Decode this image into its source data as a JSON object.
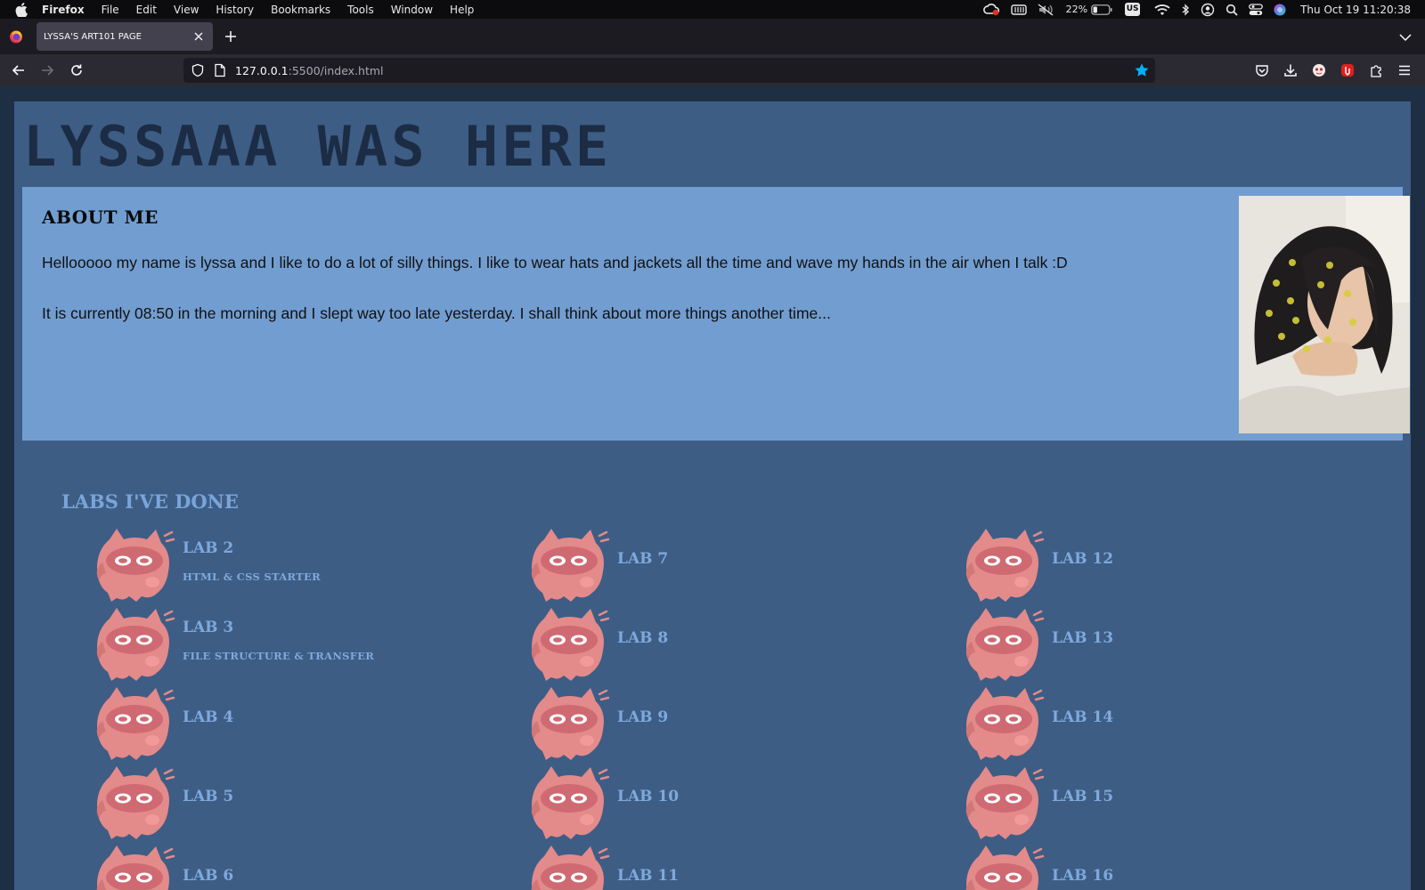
{
  "menubar": {
    "app": "Firefox",
    "items": [
      "File",
      "Edit",
      "View",
      "History",
      "Bookmarks",
      "Tools",
      "Window",
      "Help"
    ],
    "battery": "22%",
    "input_source": "US",
    "clock": "Thu Oct 19  11:20:38"
  },
  "browser": {
    "tab_title": "LYSSA'S ART101 PAGE",
    "url_host": "127.0.0.1",
    "url_rest": ":5500/index.html",
    "accent": "#00b3f4"
  },
  "page": {
    "headline": "LYSSAAA WAS HERE",
    "about": {
      "heading": "ABOUT ME",
      "p1": "Hellooooo my name is lyssa and I like to do a lot of silly things. I like to wear hats and jackets all the time and wave my hands in the air when I talk :D",
      "p2": "It is currently 08:50 in the morning and I slept way too late yesterday. I shall think about more things another time..."
    },
    "labs_heading": "LABS I'VE DONE",
    "labs": [
      {
        "name": "LAB 2",
        "sub": "HTML & CSS STARTER"
      },
      {
        "name": "LAB 3",
        "sub": "FILE STRUCTURE & TRANSFER"
      },
      {
        "name": "LAB 4",
        "sub": ""
      },
      {
        "name": "LAB 5",
        "sub": ""
      },
      {
        "name": "LAB 6",
        "sub": ""
      },
      {
        "name": "LAB 7",
        "sub": ""
      },
      {
        "name": "LAB 8",
        "sub": ""
      },
      {
        "name": "LAB 9",
        "sub": ""
      },
      {
        "name": "LAB 10",
        "sub": ""
      },
      {
        "name": "LAB 11",
        "sub": ""
      },
      {
        "name": "LAB 12",
        "sub": ""
      },
      {
        "name": "LAB 13",
        "sub": ""
      },
      {
        "name": "LAB 14",
        "sub": ""
      },
      {
        "name": "LAB 15",
        "sub": ""
      },
      {
        "name": "LAB 16",
        "sub": ""
      }
    ],
    "colors": {
      "background": "#1e2f44",
      "panel": "#3d5d85",
      "about_panel": "#729dd0",
      "lab_text": "#7fa9dc",
      "mascot": "#e08080"
    }
  }
}
